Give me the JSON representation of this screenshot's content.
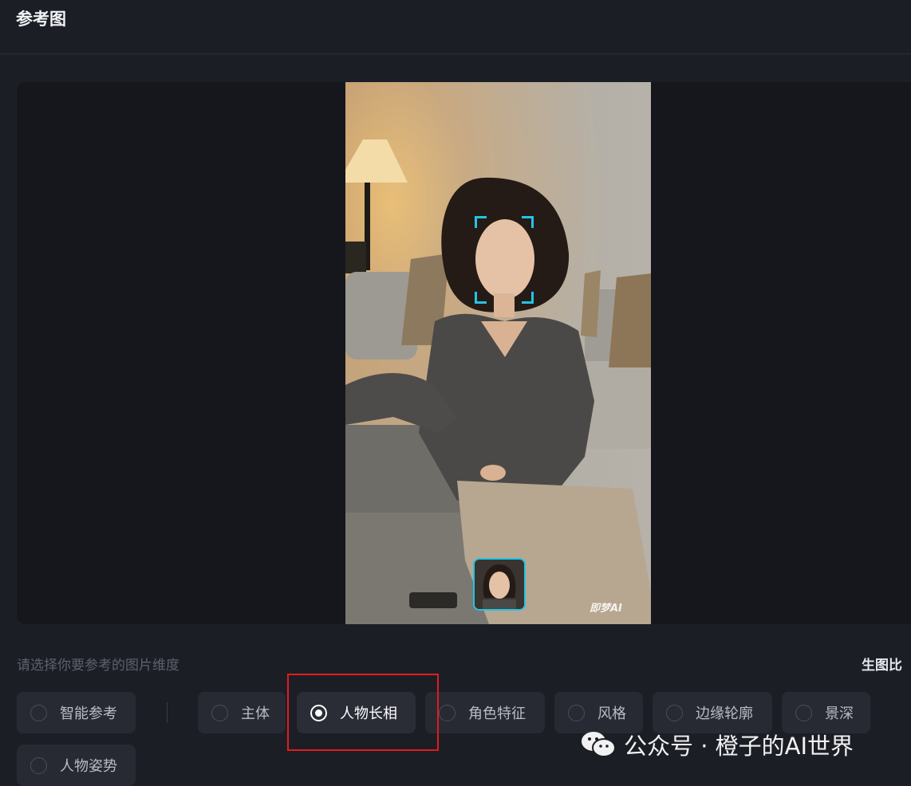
{
  "header": {
    "title": "参考图"
  },
  "preview": {
    "image_watermark": "即梦AI"
  },
  "dimension": {
    "hint": "请选择你要参考的图片维度",
    "ratio_label": "生图比",
    "options": [
      {
        "label": "智能参考",
        "selected": false
      },
      {
        "label": "主体",
        "selected": false
      },
      {
        "label": "人物长相",
        "selected": true
      },
      {
        "label": "角色特征",
        "selected": false
      },
      {
        "label": "风格",
        "selected": false
      },
      {
        "label": "边缘轮廓",
        "selected": false
      },
      {
        "label": "景深",
        "selected": false
      },
      {
        "label": "人物姿势",
        "selected": false
      }
    ]
  },
  "overlay": {
    "watermark": "公众号 · 橙子的AI世界",
    "watermark_icon": "wechat-icon"
  },
  "colors": {
    "accent": "#23c4e3",
    "highlight": "#e01d1d",
    "background": "#1c1e26"
  }
}
